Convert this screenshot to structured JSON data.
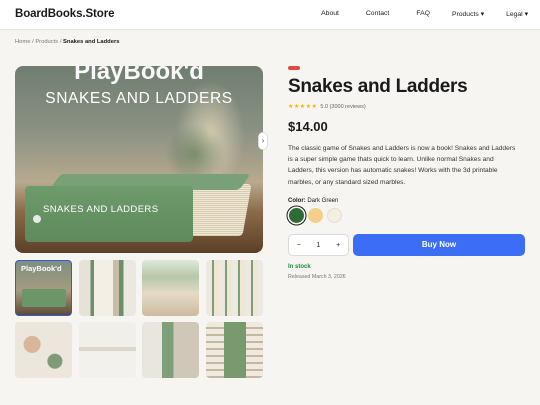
{
  "header": {
    "brand": "BoardBooks.Store",
    "nav": [
      "About",
      "Contact",
      "FAQ",
      "Products ▾",
      "Legal ▾"
    ]
  },
  "breadcrumb": {
    "home": "Home",
    "sep1": " / ",
    "products": "Products",
    "sep2": " / ",
    "current": "Snakes and Ladders"
  },
  "gallery": {
    "overlay_line1": "PlayBook'd",
    "overlay_line2": "SNAKES AND LADDERS",
    "spine_text": "SNAKES AND LADDERS",
    "thumb1_text": "PlayBook'd",
    "next_arrow": "›"
  },
  "product": {
    "title": "Snakes and Ladders",
    "stars": "★★★★★",
    "rating_text": "5.0 (3000 reviews)",
    "price": "$14.00",
    "description": "The classic game of Snakes and Ladders is now a book! Snakes and Ladders is a super simple game thats quick to learn. Unlike normal Snakes and Ladders, this version has automatic snakes! Works with the 3d printable marbles, or any standard sized marbles.",
    "color_label": "Color:",
    "color_value": "Dark Green",
    "colors": [
      "#2f6b34",
      "#f4cf8a",
      "#f3efe2"
    ],
    "qty_minus": "−",
    "qty_value": "1",
    "qty_plus": "+",
    "buy_label": "Buy Now",
    "stock": "In stock",
    "released": "Released March 3, 2026"
  },
  "accent": {
    "buy_button": "#3b6ef5",
    "stock_green": "#1b8a3a",
    "badge_red": "#e04a3c"
  }
}
